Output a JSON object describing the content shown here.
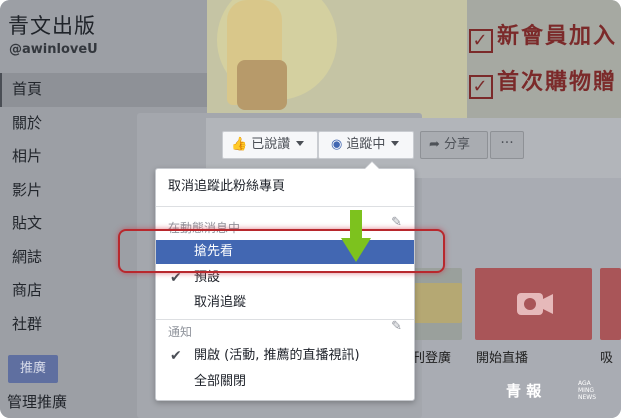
{
  "page": {
    "name": "青文出版",
    "handle": "@awinloveU"
  },
  "sidebar": {
    "items": [
      {
        "label": "首頁",
        "active": true
      },
      {
        "label": "關於"
      },
      {
        "label": "相片"
      },
      {
        "label": "影片"
      },
      {
        "label": "貼文"
      },
      {
        "label": "網誌"
      },
      {
        "label": "商店"
      },
      {
        "label": "社群"
      }
    ],
    "promote_label": "推廣",
    "manage_label": "管理推廣"
  },
  "cover": {
    "line1": "新會員加入",
    "line2": "首次購物贈"
  },
  "actions": {
    "liked_label": "已說讚",
    "following_label": "追蹤中",
    "share_label": "分享",
    "more_label": "···"
  },
  "tiles": {
    "label_live": "開始直播",
    "label_ad": "刊登廣",
    "label_partial": "吸"
  },
  "dropdown": {
    "unfollow_page": "取消追蹤此粉絲專頁",
    "section_newsfeed": "在動態消息中",
    "see_first": "搶先看",
    "default": "預設",
    "unfollow": "取消追蹤",
    "section_notifications": "通知",
    "notif_on": "開啟 (活動, 推薦的直播視訊)",
    "notif_all_off": "全部關閉"
  },
  "watermark": {
    "logo": "青  報",
    "sub": "AGA MING NEWS"
  },
  "colors": {
    "fb_blue": "#4267b2",
    "highlight_red": "#b8282d",
    "arrow_green": "#7dc21e"
  }
}
